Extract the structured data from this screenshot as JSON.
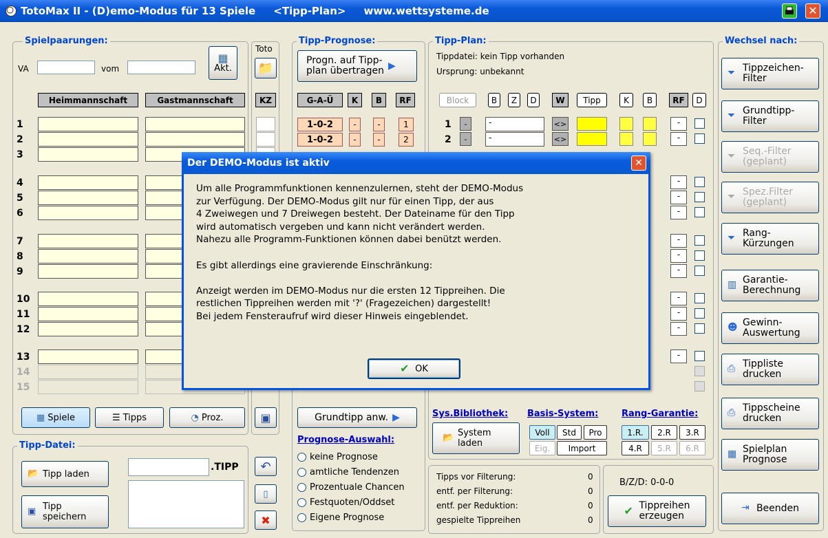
{
  "window": {
    "title": "TotoMax II - (D)emo-Modus für 13 Spiele     <Tipp-Plan>     www.wettsysteme.de"
  },
  "spiel": {
    "group_title": "Spielpaarungen:",
    "va_label": "VA",
    "vom_label": "vom",
    "akt_label": "Akt.",
    "toto_label": "Toto",
    "heim_header": "Heimmannschaft",
    "gast_header": "Gastmannschaft",
    "kz_header": "KZ",
    "rows": [
      "1",
      "2",
      "3",
      "4",
      "5",
      "6",
      "7",
      "8",
      "9",
      "10",
      "11",
      "12",
      "13"
    ],
    "inactive_rows": [
      "14",
      "15"
    ],
    "spiele_btn": "Spiele",
    "tipps_btn": "Tipps",
    "proz_btn": "Proz."
  },
  "prognose": {
    "group_title": "Tipp-Prognose:",
    "uebertragen_btn": "Progn. auf Tipp-\nplan übertragen",
    "headers": [
      "G-A-Ü",
      "K",
      "B",
      "RF"
    ],
    "row_values": [
      {
        "gau": "1-0-2",
        "k": "-",
        "b": "-",
        "rf": "1"
      },
      {
        "gau": "1-0-2",
        "k": "-",
        "b": "-",
        "rf": "2"
      }
    ],
    "grundtipp_btn": "Grundtipp anw.",
    "auswahl_title": "Prognose-Auswahl:",
    "options": [
      "keine Prognose",
      "amtliche Tendenzen",
      "Prozentuale Chancen",
      "Festquoten/Oddset",
      "Eigene Prognose"
    ]
  },
  "plan": {
    "group_title": "Tipp-Plan:",
    "tippdatei": "Tippdatei:  kein Tipp vorhanden",
    "ursprung": "Ursprung:  unbekannt",
    "headers": [
      "Block",
      "B",
      "Z",
      "D",
      "W",
      "Tipp",
      "K",
      "B",
      "RF",
      "D"
    ],
    "rows": [
      {
        "n": "1",
        "v": "-",
        "w": "<>"
      },
      {
        "n": "2",
        "v": "-",
        "w": "<>"
      }
    ],
    "dash": "-",
    "sys_bib": "Sys.Bibliothek:",
    "system_laden": "System\nladen",
    "basis": "Basis-System:",
    "basis_btns": [
      "Voll",
      "Std",
      "Pro"
    ],
    "eig": "Eig.",
    "import": "Import",
    "rang": "Rang-Garantie:",
    "rang_btns": [
      "1.R.",
      "2.R",
      "3.R",
      "4.R",
      "5.R",
      "6.R"
    ],
    "stats": [
      {
        "label": "Tipps vor Filterung:",
        "value": "0"
      },
      {
        "label": "entf. per Filterung:",
        "value": "0"
      },
      {
        "label": "entf. per Reduktion:",
        "value": "0"
      },
      {
        "label": "gespielte Tippreihen",
        "value": "0"
      }
    ],
    "bzd": "B/Z/D:  0-0-0",
    "erzeugen_btn": "Tippreihen\nerzeugen"
  },
  "wechsel": {
    "group_title": "Wechsel nach:",
    "buttons": [
      {
        "label": "Tippzeichen-\nFilter",
        "enabled": true
      },
      {
        "label": "Grundtipp-\nFilter",
        "enabled": true
      },
      {
        "label": "Seq.-Filter\n(geplant)",
        "enabled": false
      },
      {
        "label": "Spez.Filter\n(geplant)",
        "enabled": false
      },
      {
        "label": "Rang-\nKürzungen",
        "enabled": true
      },
      {
        "label": "Garantie-\nBerechnung",
        "enabled": true
      },
      {
        "label": "Gewinn-\nAuswertung",
        "enabled": true
      },
      {
        "label": "Tippliste\ndrucken",
        "enabled": true
      },
      {
        "label": "Tippscheine\ndrucken",
        "enabled": true
      },
      {
        "label": "Spielplan\nPrognose",
        "enabled": true
      }
    ],
    "beenden": "Beenden"
  },
  "datei": {
    "group_title": "Tipp-Datei:",
    "laden": "Tipp laden",
    "speichern": "Tipp\nspeichern",
    "ext": ".TIPP"
  },
  "dialog": {
    "title": "Der DEMO-Modus ist aktiv",
    "text": "Um alle Programmfunktionen kennenzulernen, steht der DEMO-Modus\nzur Verfügung. Der DEMO-Modus gilt nur für einen Tipp, der aus\n4 Zweiwegen und 7 Dreiwegen besteht. Der Dateiname für den Tipp\nwird automatisch vergeben und kann nicht verändert werden.\nNahezu alle Programm-Funktionen können dabei benützt werden.\n\nEs gibt allerdings eine gravierende Einschränkung:\n\nAnzeigt werden im DEMO-Modus nur die ersten 12 Tippreihen. Die\nrestlichen Tippreihen werden mit '?' (Fragezeichen) dargestellt!\nBei jedem Fensteraufruf wird dieser Hinweis eingeblendet.",
    "ok": "OK"
  },
  "colors": {
    "titlebar": "#0a58d8",
    "accent": "#0046d5",
    "yellow": "#ffff00",
    "peach": "#ffd8b8"
  }
}
